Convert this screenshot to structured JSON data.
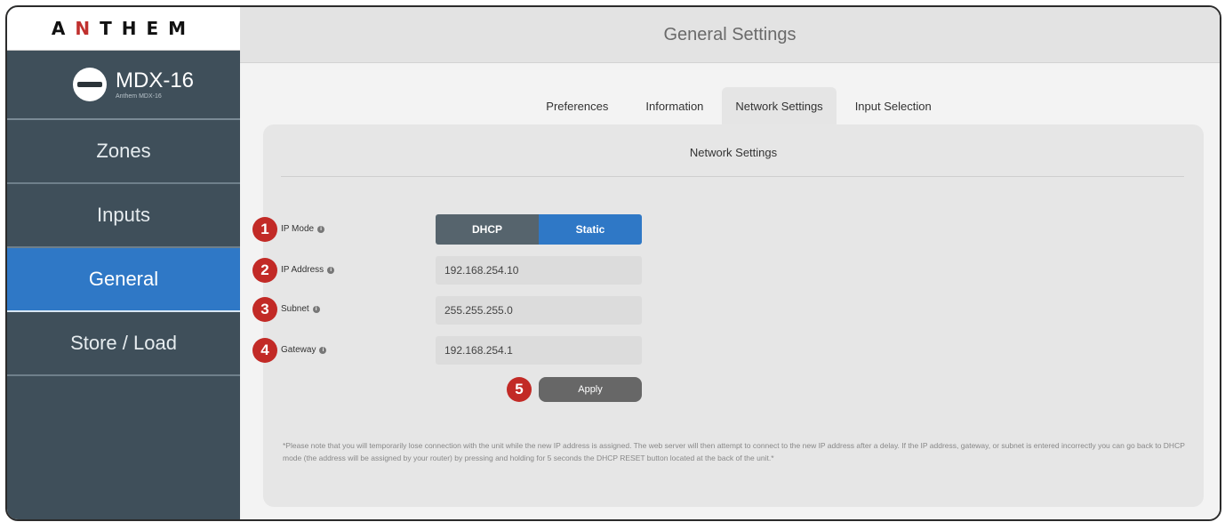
{
  "brand": {
    "logo_text": "ANTHEM",
    "device_name": "MDX-16",
    "device_sub": "Anthem MDX-16"
  },
  "sidebar": {
    "items": [
      {
        "label": "Zones",
        "active": false
      },
      {
        "label": "Inputs",
        "active": false
      },
      {
        "label": "General",
        "active": true
      },
      {
        "label": "Store / Load",
        "active": false
      }
    ]
  },
  "header": {
    "title": "General Settings"
  },
  "tabs": [
    {
      "label": "Preferences",
      "active": false
    },
    {
      "label": "Information",
      "active": false
    },
    {
      "label": "Network Settings",
      "active": true
    },
    {
      "label": "Input Selection",
      "active": false
    }
  ],
  "panel": {
    "title": "Network Settings",
    "ip_mode": {
      "step": "1",
      "label": "IP Mode",
      "options": [
        "DHCP",
        "Static"
      ],
      "selected": "Static"
    },
    "ip_address": {
      "step": "2",
      "label": "IP Address",
      "value": "192.168.254.10"
    },
    "subnet": {
      "step": "3",
      "label": "Subnet",
      "value": "255.255.255.0"
    },
    "gateway": {
      "step": "4",
      "label": "Gateway",
      "value": "192.168.254.1"
    },
    "apply": {
      "step": "5",
      "label": "Apply"
    },
    "note": "*Please note that you will temporarily lose connection with the unit while the new IP address is assigned. The web server will then attempt to connect to the new IP address after a delay. If the IP address, gateway, or subnet is entered incorrectly you can go back to DHCP mode (the address will be assigned by your router) by pressing and holding for 5 seconds the DHCP RESET button located at the back of the unit.*"
  },
  "colors": {
    "accent": "#2f78c6",
    "sidebar": "#3f4f5a",
    "step_badge": "#c22a26",
    "apply_button": "#676767"
  }
}
